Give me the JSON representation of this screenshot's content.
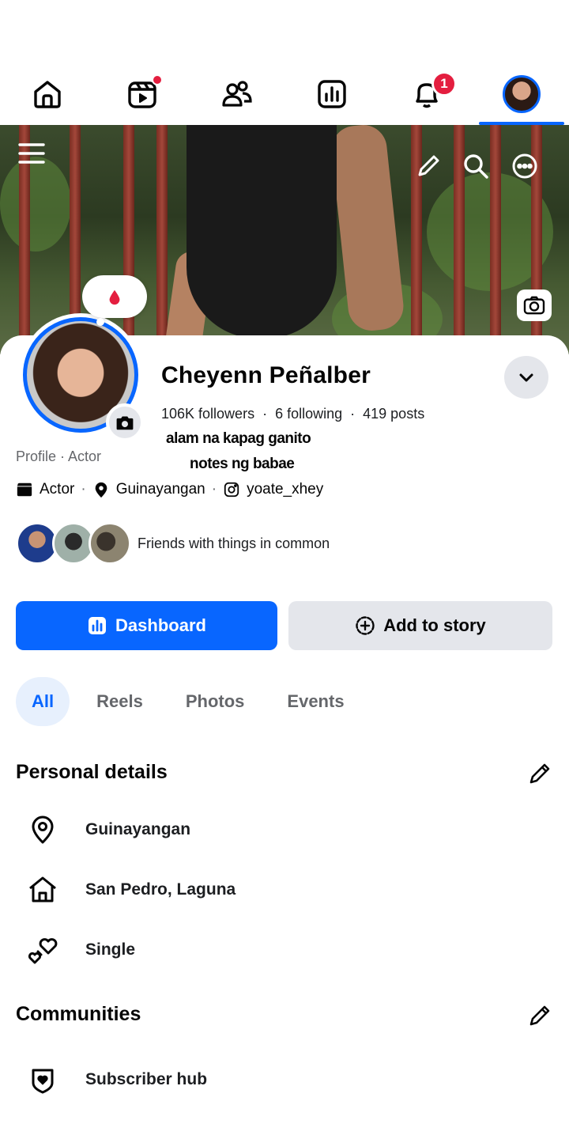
{
  "nav": {
    "items": [
      {
        "name": "home"
      },
      {
        "name": "reels",
        "has_dot": true
      },
      {
        "name": "friends"
      },
      {
        "name": "dashboard"
      },
      {
        "name": "notifications",
        "badge": "1"
      },
      {
        "name": "profile",
        "active": true
      }
    ]
  },
  "colors": {
    "accent": "#0866ff",
    "badge": "#e41e3f",
    "button_grey": "#e4e6eb",
    "tab_active_bg": "#e7f0fd"
  },
  "note": {
    "emoji_icon": "blood-drop-icon"
  },
  "profile": {
    "name": "Cheyenn Peñalber",
    "followers": "106K followers",
    "following": "6 following",
    "posts": "419 posts",
    "note_line1": "alam na kapag ganito",
    "note_line2": "notes ng babae",
    "subtitle": "Profile · Actor"
  },
  "meta": {
    "category": "Actor",
    "location": "Guinayangan",
    "instagram": "yoate_xhey",
    "separator": "·"
  },
  "friends": {
    "label": "Friends with things in common"
  },
  "buttons": {
    "dashboard": "Dashboard",
    "add_story": "Add to story"
  },
  "tabs": [
    "All",
    "Reels",
    "Photos",
    "Events"
  ],
  "personal_details": {
    "title": "Personal details",
    "items": [
      "Guinayangan",
      "San Pedro, Laguna",
      "Single"
    ]
  },
  "communities": {
    "title": "Communities",
    "items": [
      "Subscriber hub"
    ]
  }
}
